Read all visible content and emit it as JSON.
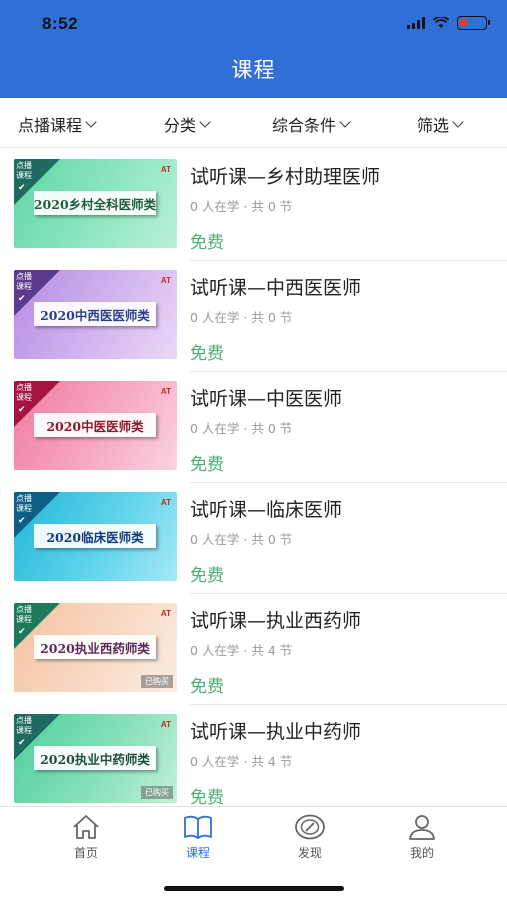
{
  "status_bar": {
    "time": "8:52"
  },
  "header": {
    "title": "课程"
  },
  "filters": [
    "点播课程",
    "分类",
    "综合条件",
    "筛选"
  ],
  "courses": [
    {
      "title": "试听课—乡村助理医师",
      "meta": "0 人在学 · 共 0 节",
      "price": "免费",
      "thumb_text": "2020乡村全科医师类",
      "tag": "点播课程",
      "bought": ""
    },
    {
      "title": "试听课—中西医医师",
      "meta": "0 人在学 · 共 0 节",
      "price": "免费",
      "thumb_text": "2020中西医医师类",
      "tag": "点播课程",
      "bought": ""
    },
    {
      "title": "试听课—中医医师",
      "meta": "0 人在学 · 共 0 节",
      "price": "免费",
      "thumb_text": "2020中医医师类",
      "tag": "点播课程",
      "bought": ""
    },
    {
      "title": "试听课—临床医师",
      "meta": "0 人在学 · 共 0 节",
      "price": "免费",
      "thumb_text": "2020临床医师类",
      "tag": "点播课程",
      "bought": ""
    },
    {
      "title": "试听课—执业西药师",
      "meta": "0 人在学 · 共 4 节",
      "price": "免费",
      "thumb_text": "2020执业西药师类",
      "tag": "点播课程",
      "bought": "已购买"
    },
    {
      "title": "试听课—执业中药师",
      "meta": "0 人在学 · 共 4 节",
      "price": "免费",
      "thumb_text": "2020执业中药师类",
      "tag": "点播课程",
      "bought": "已购买"
    }
  ],
  "tabbar": {
    "items": [
      {
        "label": "首页",
        "icon": "home-icon"
      },
      {
        "label": "课程",
        "icon": "book-icon"
      },
      {
        "label": "发现",
        "icon": "compass-icon"
      },
      {
        "label": "我的",
        "icon": "user-icon"
      }
    ],
    "active": "课程"
  },
  "colors": {
    "header": "#2f6fd6",
    "price": "#4caf73",
    "active_tab": "#2f6fd6"
  }
}
